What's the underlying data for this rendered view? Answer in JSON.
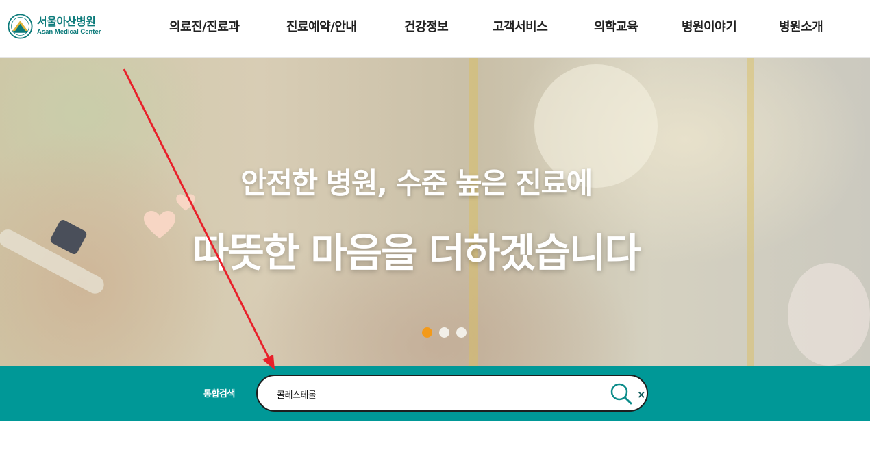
{
  "header": {
    "logo": {
      "kr": "서울아산병원",
      "en": "Asan Medical Center"
    },
    "nav": [
      {
        "label": "의료진/진료과"
      },
      {
        "label": "진료예약/안내"
      },
      {
        "label": "건강정보"
      },
      {
        "label": "고객서비스"
      },
      {
        "label": "의학교육"
      },
      {
        "label": "병원이야기"
      },
      {
        "label": "병원소개"
      }
    ]
  },
  "hero": {
    "line1": "안전한 병원, 수준 높은 진료에",
    "line2": "따뜻한 마음을 더하겠습니다",
    "slides": {
      "count": 3,
      "active": 1
    }
  },
  "search": {
    "label": "통합검색",
    "value": "콜레스테롤",
    "search_icon": "search-icon",
    "clear_icon": "close-icon",
    "clear_symbol": "×"
  },
  "colors": {
    "brand": "#0b7a7a",
    "band": "#009897",
    "dot_active": "#f39a1a",
    "annotation": "#e8202a"
  }
}
